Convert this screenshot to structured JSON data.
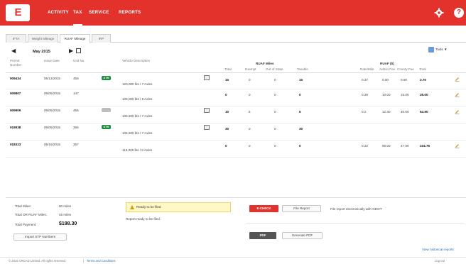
{
  "app": {
    "logo_text": "E",
    "brand_color": "#e3312b",
    "nav": [
      {
        "label": "ACTIVITY",
        "active": false
      },
      {
        "label": "TAX",
        "active": true
      },
      {
        "label": "SERVICE",
        "active": false
      },
      {
        "label": "REPORTS",
        "active": false
      }
    ],
    "settings_icon": "gear-icon",
    "help_icon": "help-icon",
    "help_label": "?"
  },
  "tabs": [
    {
      "label": "IFTA",
      "active": false
    },
    {
      "label": "Weight Mileage",
      "active": false
    },
    {
      "label": "RUAF Mileage",
      "active": true
    },
    {
      "label": "IRP",
      "active": false
    }
  ],
  "period": {
    "label": "May 2015"
  },
  "tools": {
    "label": "Tools"
  },
  "table": {
    "headers": {
      "permit": "Permit Number",
      "issue_date": "Issue Date",
      "unit": "Unit No",
      "vehicle": "Vehicle Description",
      "ruaf_miles": "RUAF Miles",
      "ruaf_dollars": "RUAF ($)"
    },
    "subheaders": {
      "total": "Total",
      "exempt": "Exempt",
      "out_of_state": "Out of State",
      "taxable": "Taxable",
      "rate_mile": "Rate/Mile",
      "admin_fee": "Admin Fee",
      "county_fee": "County Fee",
      "total_dollars": "Total"
    },
    "rows": [
      {
        "permit": "909434",
        "date": "05/13/2015",
        "unit": "455",
        "badge": "STR",
        "badge_type": "ok",
        "desc": "120,000 lbs / 7 Axles",
        "doc": true,
        "total": "10",
        "exempt": "0",
        "oos": "0",
        "taxable": "10",
        "rate": "0.37",
        "admin": "0.00",
        "county": "0.90",
        "sum": "3.70"
      },
      {
        "permit": "909807",
        "date": "05/05/2015",
        "unit": "147",
        "badge": "",
        "badge_type": "",
        "desc": "105,000 lbs / 6 Axles",
        "doc": false,
        "total": "0",
        "exempt": "0",
        "oos": "0",
        "taxable": "0",
        "rate": "0.39",
        "admin": "10.00",
        "county": "15.00",
        "sum": "25.00"
      },
      {
        "permit": "909909",
        "date": "05/05/2015",
        "unit": "456",
        "badge": "",
        "badge_type": "gray",
        "desc": "106,500 lbs / 7 Axles",
        "doc": true,
        "total": "10",
        "exempt": "5",
        "oos": "0",
        "taxable": "5",
        "rate": "0.2",
        "admin": "12.30",
        "county": "40.60",
        "sum": "54.90"
      },
      {
        "permit": "918938",
        "date": "05/05/2015",
        "unit": "356",
        "badge": "STR",
        "badge_type": "ok",
        "desc": "105,500 lbs / 7 Axles",
        "doc": true,
        "total": "30",
        "exempt": "0",
        "oos": "0",
        "taxable": "30",
        "rate": "",
        "admin": "",
        "county": "",
        "sum": ""
      },
      {
        "permit": "918323",
        "date": "05/15/2015",
        "unit": "357",
        "badge": "",
        "badge_type": "",
        "desc": "115,000 lbs / 8 Axles",
        "doc": false,
        "total": "0",
        "exempt": "0",
        "oos": "0",
        "taxable": "0",
        "rate": "0.22",
        "admin": "56.00",
        "county": "47.90",
        "sum": "104.76"
      }
    ]
  },
  "summary": {
    "total_miles_label": "Total Miles:",
    "total_miles_value": "50 miles",
    "total_or_label": "Total OR RUAF Miles:",
    "total_or_value": "45 miles",
    "total_payment_label": "Total Payment:",
    "total_payment_value": "$198.30",
    "import_button": "Import STP Numbers"
  },
  "status": {
    "alert": "Ready to be filed",
    "message": "Report ready to be filed."
  },
  "actions": {
    "echeck_label": "E-CHECK",
    "file_report_label": "File Report",
    "file_note": "File report electronically with ODOT",
    "pdf_label": "PDF",
    "generate_pdf_label": "Generate PDF",
    "history_link": "View historical reports"
  },
  "footer": {
    "copyright": "© 2015 CRCAD Limited. All rights reserved.",
    "terms": "Terms and Conditions",
    "logout": "Log out"
  }
}
